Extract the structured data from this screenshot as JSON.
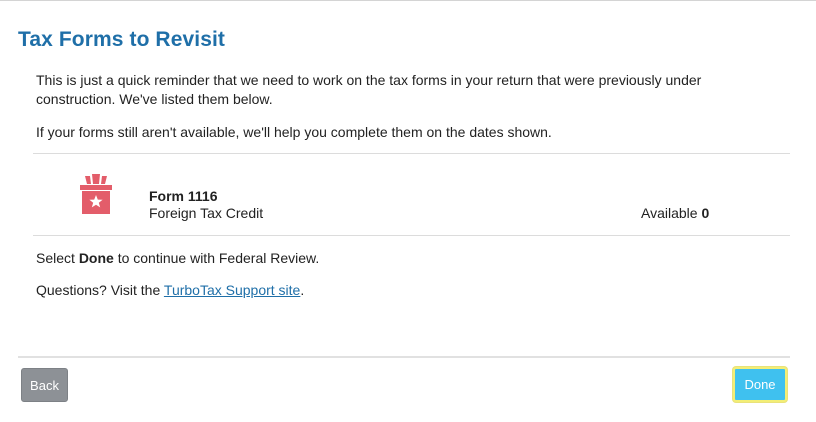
{
  "page": {
    "title": "Tax Forms to Revisit",
    "intro": "This is just a quick reminder that we need to work on the tax forms in your return that were previously under construction. We've listed them below.",
    "availability_note": "If your forms still aren't available, we'll help you complete them on the dates shown."
  },
  "forms": [
    {
      "name": "Form 1116",
      "description": "Foreign Tax Credit",
      "available_label": "Available",
      "available_value": "0",
      "icon": "under-construction-box-icon"
    }
  ],
  "instructions": {
    "prefix": "Select ",
    "bold": "Done",
    "suffix": " to continue with Federal Review."
  },
  "questions": {
    "prefix": "Questions? Visit the ",
    "link_text": "TurboTax Support site",
    "suffix": "."
  },
  "footer": {
    "back_label": "Back",
    "done_label": "Done"
  },
  "colors": {
    "title": "#1f6fa8",
    "link": "#1f6fa8",
    "icon": "#e35d6a",
    "back_button": "#8d9196",
    "done_button": "#3fc1ef",
    "done_focus_ring": "#f3ee76"
  }
}
